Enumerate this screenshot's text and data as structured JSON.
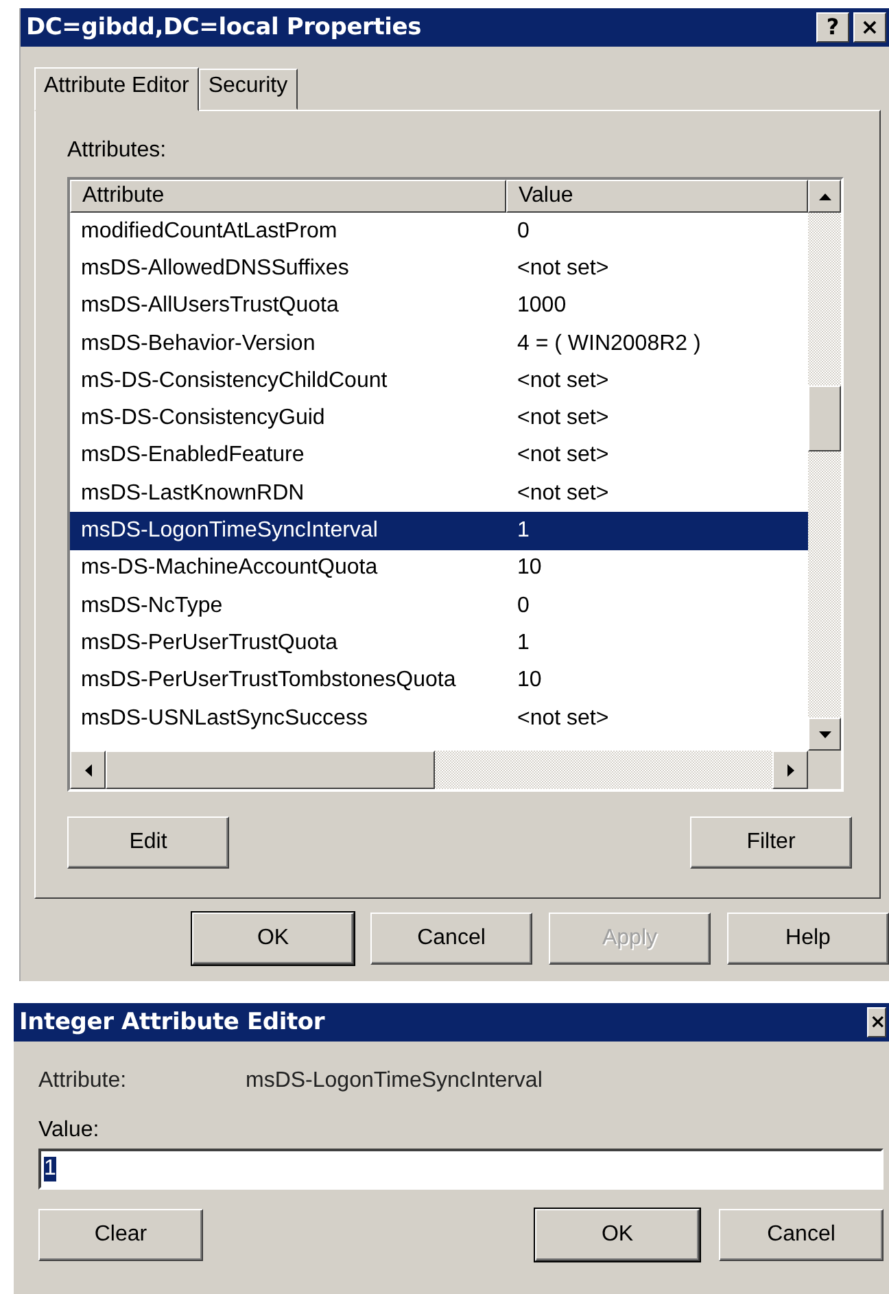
{
  "properties_dialog": {
    "title": "DC=gibdd,DC=local Properties",
    "title_buttons": [
      "?",
      "×"
    ],
    "tabs": [
      {
        "label": "Attribute Editor",
        "selected": true
      },
      {
        "label": "Security",
        "selected": false
      }
    ],
    "attributes_label": "Attributes:",
    "table": {
      "columns": [
        "Attribute",
        "Value"
      ],
      "rows": [
        {
          "attribute": "modifiedCountAtLastProm",
          "value": "0",
          "selected": false
        },
        {
          "attribute": "msDS-AllowedDNSSuffixes",
          "value": "<not set>",
          "selected": false
        },
        {
          "attribute": "msDS-AllUsersTrustQuota",
          "value": "1000",
          "selected": false
        },
        {
          "attribute": "msDS-Behavior-Version",
          "value": "4 = ( WIN2008R2 )",
          "selected": false
        },
        {
          "attribute": "mS-DS-ConsistencyChildCount",
          "value": "<not set>",
          "selected": false
        },
        {
          "attribute": "mS-DS-ConsistencyGuid",
          "value": "<not set>",
          "selected": false
        },
        {
          "attribute": "msDS-EnabledFeature",
          "value": "<not set>",
          "selected": false
        },
        {
          "attribute": "msDS-LastKnownRDN",
          "value": "<not set>",
          "selected": false
        },
        {
          "attribute": "msDS-LogonTimeSyncInterval",
          "value": "1",
          "selected": true
        },
        {
          "attribute": "ms-DS-MachineAccountQuota",
          "value": "10",
          "selected": false
        },
        {
          "attribute": "msDS-NcType",
          "value": "0",
          "selected": false
        },
        {
          "attribute": "msDS-PerUserTrustQuota",
          "value": "1",
          "selected": false
        },
        {
          "attribute": "msDS-PerUserTrustTombstonesQuota",
          "value": "10",
          "selected": false
        },
        {
          "attribute": "msDS-USNLastSyncSuccess",
          "value": "<not set>",
          "selected": false
        }
      ]
    },
    "panel_buttons": [
      {
        "label": "Edit",
        "disabled": false
      },
      {
        "label": "Filter",
        "disabled": false
      }
    ],
    "buttons": [
      {
        "label": "OK",
        "disabled": false,
        "default": true
      },
      {
        "label": "Cancel",
        "disabled": false,
        "default": false
      },
      {
        "label": "Apply",
        "disabled": true,
        "default": false
      },
      {
        "label": "Help",
        "disabled": false,
        "default": false
      }
    ]
  },
  "editor_dialog": {
    "title": "Integer Attribute Editor",
    "close_button": "×",
    "attribute_label": "Attribute:",
    "attribute_name": "msDS-LogonTimeSyncInterval",
    "value_label": "Value:",
    "value": "1",
    "buttons": [
      {
        "label": "Clear",
        "disabled": false,
        "default": false
      },
      {
        "label": "OK",
        "disabled": false,
        "default": true
      },
      {
        "label": "Cancel",
        "disabled": false,
        "default": false
      }
    ]
  }
}
